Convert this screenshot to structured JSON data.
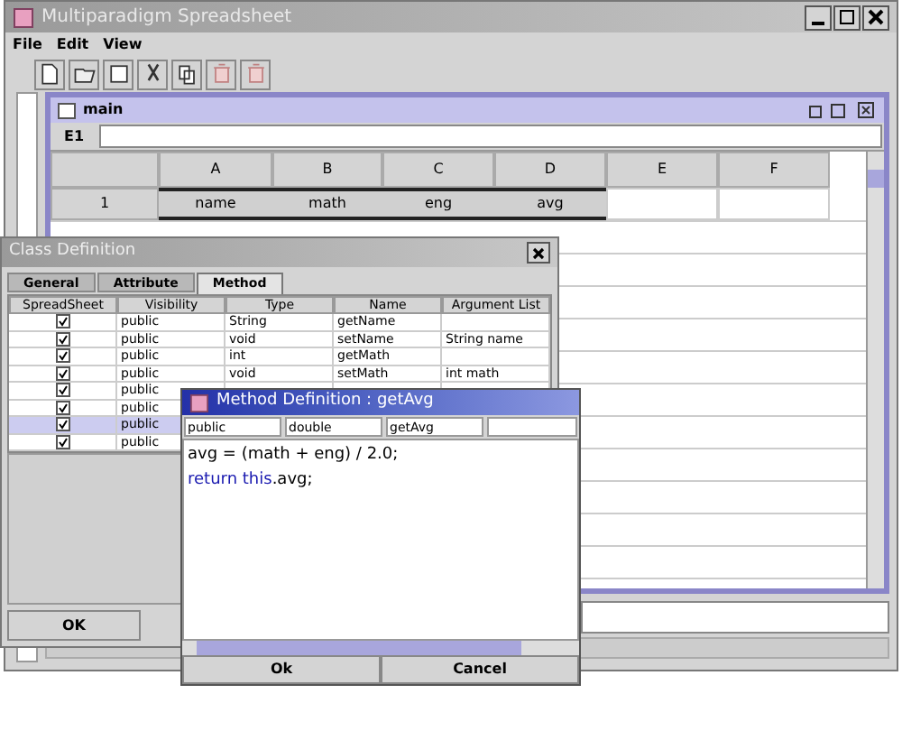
{
  "main_window": {
    "title": "Multiparadigm Spreadsheet",
    "menu": [
      "File",
      "Edit",
      "View"
    ],
    "toolbar": [
      {
        "kind": "new",
        "disabled": false
      },
      {
        "kind": "open",
        "disabled": false
      },
      {
        "kind": "save",
        "disabled": false
      },
      {
        "kind": "cut",
        "disabled": false
      },
      {
        "kind": "copy",
        "disabled": false
      },
      {
        "kind": "delete",
        "disabled": true
      },
      {
        "kind": "delete",
        "disabled": true
      }
    ],
    "sheet": {
      "title": "main",
      "cell_ref": "E1",
      "columns": [
        "A",
        "B",
        "C",
        "D",
        "E",
        "F"
      ],
      "rows": [
        {
          "header": "1",
          "cells": [
            {
              "text": "name",
              "selected": true
            },
            {
              "text": "math",
              "selected": true
            },
            {
              "text": "eng",
              "selected": true
            },
            {
              "text": "avg",
              "selected": true
            },
            {
              "text": "",
              "selected": false
            },
            {
              "text": "",
              "selected": false
            }
          ]
        }
      ]
    }
  },
  "class_definition": {
    "title": "Class Definition",
    "tabs": [
      {
        "label": "General",
        "selected": false
      },
      {
        "label": "Attribute",
        "selected": false
      },
      {
        "label": "Method",
        "selected": true
      }
    ],
    "columns": [
      "SpreadSheet",
      "Visibility",
      "Type",
      "Name",
      "Argument List"
    ],
    "rows": [
      {
        "checked": true,
        "selected": false,
        "visibility": "public",
        "type": "String",
        "name": "getName",
        "args": ""
      },
      {
        "checked": true,
        "selected": false,
        "visibility": "public",
        "type": "void",
        "name": "setName",
        "args": "String name"
      },
      {
        "checked": true,
        "selected": false,
        "visibility": "public",
        "type": "int",
        "name": "getMath",
        "args": ""
      },
      {
        "checked": true,
        "selected": false,
        "visibility": "public",
        "type": "void",
        "name": "setMath",
        "args": "int math"
      },
      {
        "checked": true,
        "selected": false,
        "visibility": "public"
      },
      {
        "checked": true,
        "selected": false,
        "visibility": "public"
      },
      {
        "checked": true,
        "selected": true,
        "visibility": "public"
      },
      {
        "checked": true,
        "selected": false,
        "visibility": "public"
      }
    ],
    "buttons": [
      "OK"
    ]
  },
  "method_definition": {
    "title": "Method Definition : getAvg",
    "fields": [
      "public",
      "double",
      "getAvg"
    ],
    "code": [
      [
        {
          "text": "avg = (math + eng) / 2.0;",
          "kind": "plain"
        }
      ],
      [
        {
          "text": "return this",
          "kind": "keyword"
        },
        {
          "text": ".avg;",
          "kind": "plain"
        }
      ]
    ],
    "buttons": [
      "Ok",
      "Cancel"
    ]
  }
}
